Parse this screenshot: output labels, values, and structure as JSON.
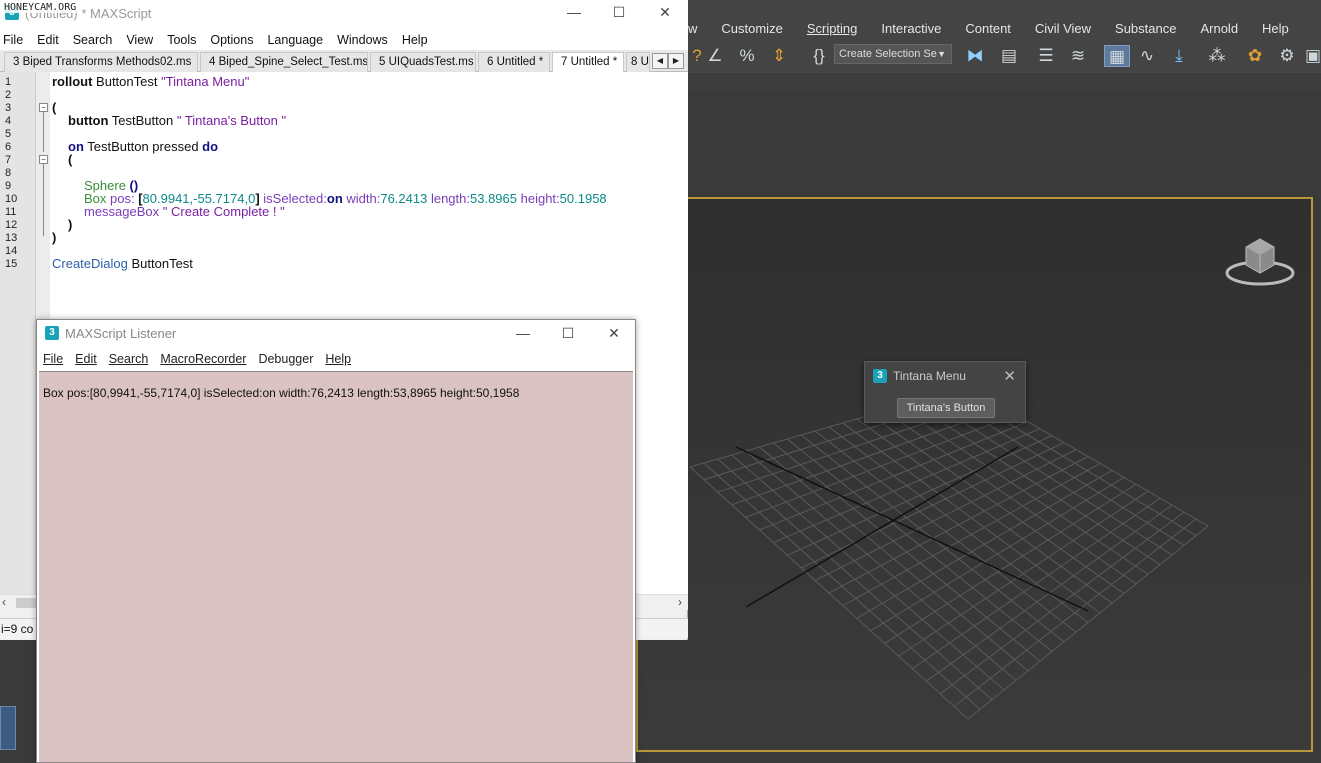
{
  "watermark": "HONEYCAM.ORG",
  "max": {
    "menubar": [
      "w",
      "Customize",
      "Scripting",
      "Interactive",
      "Content",
      "Civil View",
      "Substance",
      "Arnold",
      "Help"
    ],
    "selection_set_placeholder": "Create Selection Se"
  },
  "editor": {
    "title": "(Untitled) * MAXScript",
    "menu": [
      "File",
      "Edit",
      "Search",
      "View",
      "Tools",
      "Options",
      "Language",
      "Windows",
      "Help"
    ],
    "tabs": [
      {
        "label": "3 Biped Transforms Methods02.ms",
        "active": false
      },
      {
        "label": "4 Biped_Spine_Select_Test.ms",
        "active": false
      },
      {
        "label": "5 UIQuadsTest.ms",
        "active": false
      },
      {
        "label": "6 Untitled *",
        "active": false
      },
      {
        "label": "7 Untitled *",
        "active": true
      },
      {
        "label": "8 U",
        "active": false
      }
    ],
    "line_numbers": [
      "1",
      "2",
      "3",
      "4",
      "5",
      "6",
      "7",
      "8",
      "9",
      "10",
      "11",
      "12",
      "13",
      "14",
      "15"
    ],
    "code": {
      "l1_kw": "rollout",
      "l1_name": " ButtonTest ",
      "l1_str": "\"Tintana Menu\"",
      "l3": "(",
      "l4_kw": "button",
      "l4_name": " TestButton ",
      "l4_str": "\" Tintana's Button \"",
      "l6_kw": "on",
      "l6_mid": " TestButton pressed ",
      "l6_kw2": "do",
      "l7": "(",
      "l9_fn": "Sphere ",
      "l9_paren": "()",
      "l10_fn": "Box ",
      "l10_p1": "pos:",
      "l10_b1": " [",
      "l10_vals": "80.9941,-55.7174,0",
      "l10_b2": "]",
      "l10_p2": " isSelected:",
      "l10_on": "on",
      "l10_p3": " width:",
      "l10_n3": "76.2413",
      "l10_p4": " length:",
      "l10_n4": "53.8965",
      "l10_p5": " height:",
      "l10_n5": "50.1958",
      "l11_fn": "messageBox ",
      "l11_str": "\" Create Complete ! \"",
      "l12": ")",
      "l13": ")",
      "l15_fn": "CreateDialog",
      "l15_name": " ButtonTest"
    },
    "status": "i=9 co"
  },
  "listener": {
    "title": "MAXScript Listener",
    "menu": [
      "File",
      "Edit",
      "Search",
      "MacroRecorder",
      "Debugger",
      "Help"
    ],
    "output": "Box pos:[80,9941,-55,7174,0] isSelected:on width:76,2413 length:53,8965 height:50,1958"
  },
  "dialog": {
    "title": "Tintana Menu",
    "button_label": "Tintana's Button"
  },
  "colors": {
    "listener_bg": "#dcc3c3",
    "viewport_border": "#b8983a",
    "max_bg": "#444444"
  }
}
